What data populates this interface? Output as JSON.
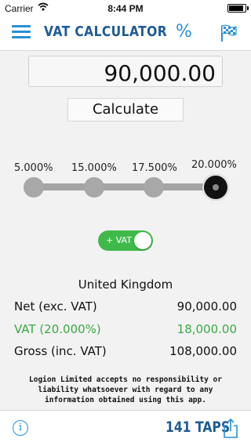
{
  "status_bar": {
    "carrier": "Carrier",
    "time": "8:44 PM",
    "battery_level": 1.0
  },
  "nav": {
    "title": "VAT CALCULATOR",
    "percent_label": "%",
    "menu_icon": "hamburger-menu-icon",
    "flag_icon": "checkered-flag-icon",
    "accent_color": "#2a8fd4",
    "title_color": "#1f5a94"
  },
  "amount": {
    "value": "90,000.00"
  },
  "calculate_label": "Calculate",
  "rate_slider": {
    "options": [
      "5.000%",
      "15.000%",
      "17.500%",
      "20.000%"
    ],
    "selected": "20.000%"
  },
  "vat_toggle": {
    "label": "+ VAT",
    "on": true,
    "color": "#3fba4a"
  },
  "results": {
    "country": "United Kingdom",
    "net_label": "Net (exc. VAT)",
    "net_value": "90,000.00",
    "vat_label": "VAT (20.000%)",
    "vat_value": "18,000.00",
    "gross_label": "Gross (inc. VAT)",
    "gross_value": "108,000.00",
    "vat_color": "#3aa944"
  },
  "disclaimer": "Logion Limited accepts no responsibility or liability whatsoever with regard to any information obtained using this app.",
  "bottom_bar": {
    "info_icon": "info-icon",
    "info_glyph": "i",
    "taps": "141 TAPS",
    "share_icon": "share-icon"
  }
}
